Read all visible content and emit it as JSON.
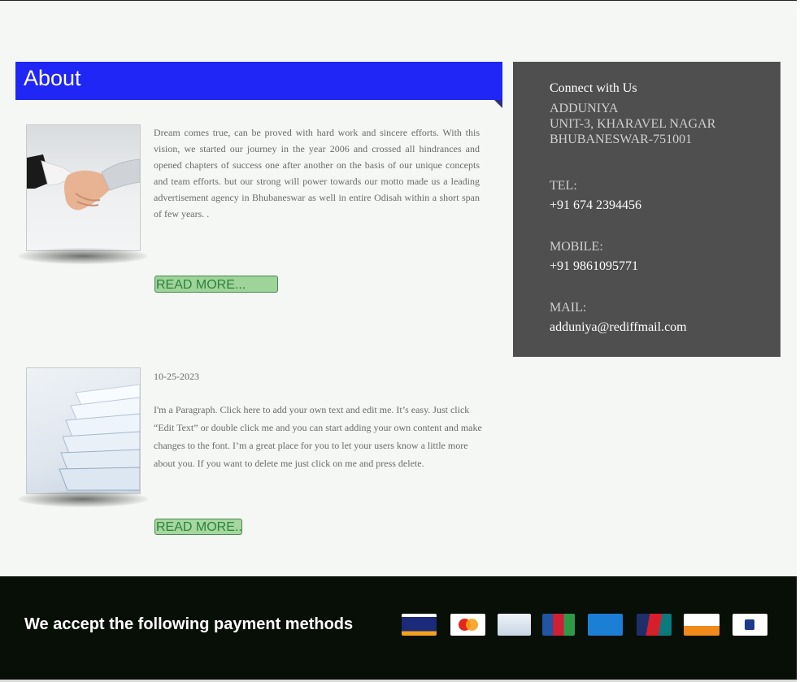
{
  "about": {
    "title": "About"
  },
  "posts": [
    {
      "image_icon": "handshake-image",
      "text": "Dream comes true, can be proved with hard work and sincere efforts. With this vision, we started our journey in the year 2006 and crossed all hindrances and opened chapters of success one after another on the basis of our unique concepts and team efforts. but our strong will power towards our motto made us a leading advertisement agency in Bhubaneswar as well in entire Odisah within a short span of few years. .",
      "read_more": "READ MORE..."
    },
    {
      "image_icon": "paper-stack-image",
      "date": "10-25-2023",
      "text": "I'm a Paragraph. Click here to add your own text and edit me. It’s easy. Just click “Edit Text” or double click me and you can start adding your own content and make changes to the font. I’m a great place for you to let your users know a little more about you. If you want to delete me just click on me and press delete.",
      "read_more": "READ MORE..."
    }
  ],
  "contact": {
    "title": "Connect with Us",
    "name": "ADDUNIYA",
    "address_line1": "UNIT-3, KHARAVEL NAGAR",
    "address_line2": "BHUBANESWAR-751001",
    "tel_label": "TEL:",
    "tel": "+91 674 2394456",
    "mobile_label": "MOBILE:",
    "mobile": "+91 9861095771",
    "mail_label": "MAIL:",
    "mail": "adduniya@rediffmail.com"
  },
  "footer": {
    "text": "We accept the following payment methods",
    "payment_icons": [
      "visa-icon",
      "mastercard-icon",
      "diners-club-icon",
      "jcb-icon",
      "american-express-icon",
      "unionpay-icon",
      "discover-icon",
      "paypal-icon"
    ]
  },
  "colors": {
    "about_banner": "#1f26f5",
    "contact_box": "#4f4f4f",
    "read_more_bg": "#9ed49a",
    "footer_bg": "#070f06"
  }
}
